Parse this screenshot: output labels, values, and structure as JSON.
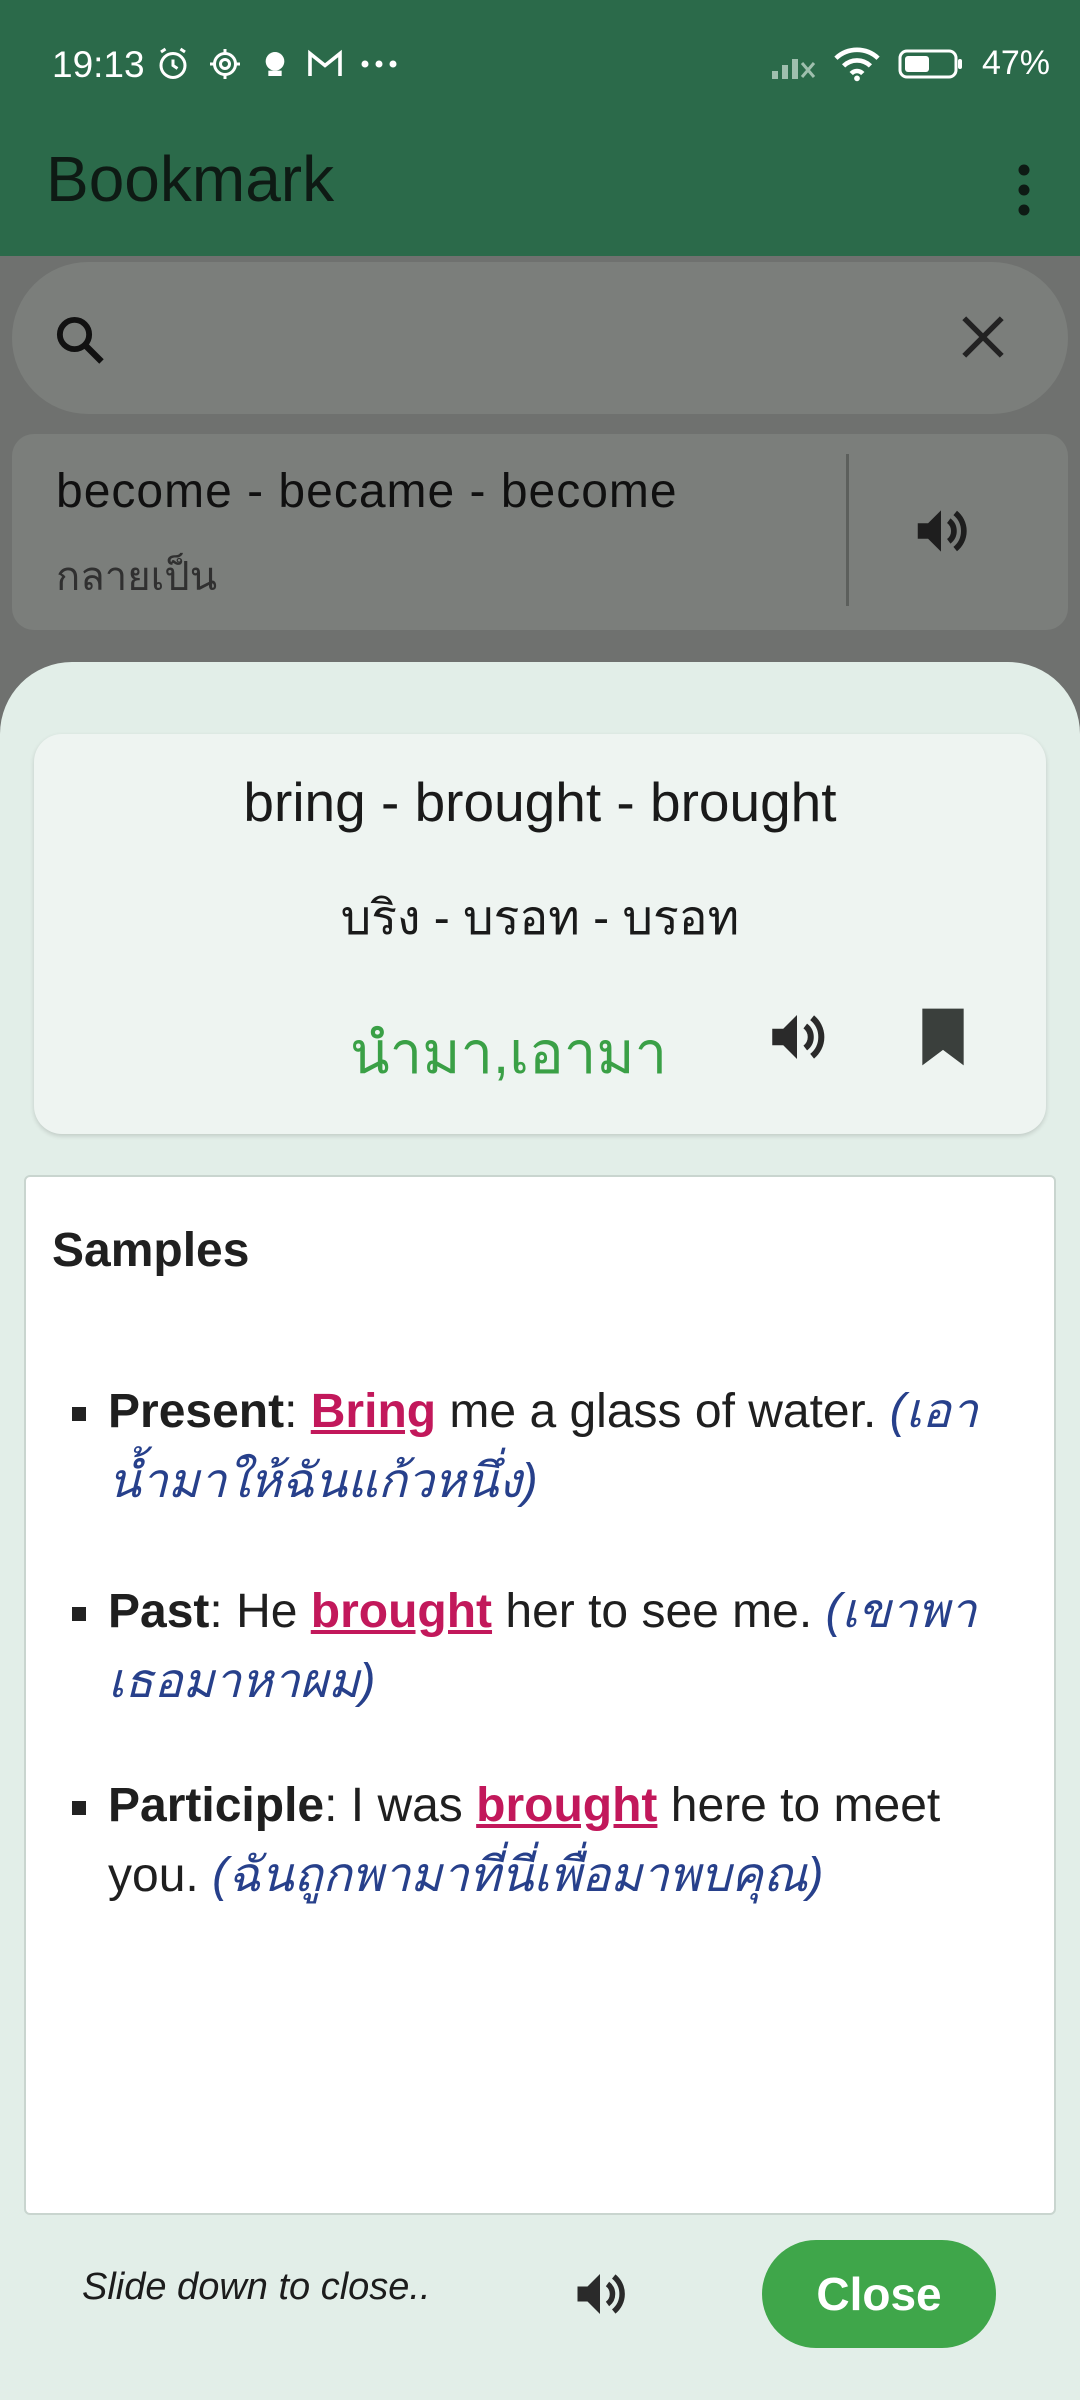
{
  "status_bar": {
    "time": "19:13",
    "battery": "47%",
    "left_icons": [
      "alarm-icon",
      "settings-gear-icon",
      "robot-icon",
      "gmail-icon",
      "more-dots-icon"
    ],
    "right_icons": [
      "signal-icon",
      "wifi-icon",
      "battery-icon"
    ]
  },
  "app_bar": {
    "title": "Bookmark",
    "menu_icon": "more-vert-icon"
  },
  "search": {
    "placeholder": "",
    "search_icon": "search-icon",
    "clear_icon": "close-icon"
  },
  "list": {
    "items": [
      {
        "word": "become - became - become",
        "meaning": "กลายเป็น"
      }
    ]
  },
  "sheet": {
    "word_forms": "bring - brought - brought",
    "pronunciation": "บริง - บรอท - บรอท",
    "meaning": "นำมา,เอามา",
    "samples_title": "Samples",
    "samples": [
      {
        "label": "Present",
        "pre": ": ",
        "key": "Bring",
        "post": " me a glass of water. ",
        "thai": "(เอาน้ำมาให้ฉันแก้วหนึ่ง)"
      },
      {
        "label": "Past",
        "pre": ": He ",
        "key": "brought",
        "post": " her to see me. ",
        "thai": "(เขาพาเธอมาหาผม)"
      },
      {
        "label": "Participle",
        "pre": ": I was ",
        "key": "brought",
        "post": " here to meet you. ",
        "thai": "(ฉันถูกพามาที่นี่เพื่อมาพบคุณ)"
      }
    ],
    "hint": "Slide down to close..",
    "close_label": "Close"
  },
  "colors": {
    "app_bar": "#2b6a4a",
    "meaning": "#3aa046",
    "key_word": "#c2185b",
    "thai_translation": "#27408b",
    "close_button": "#3fa64a"
  }
}
